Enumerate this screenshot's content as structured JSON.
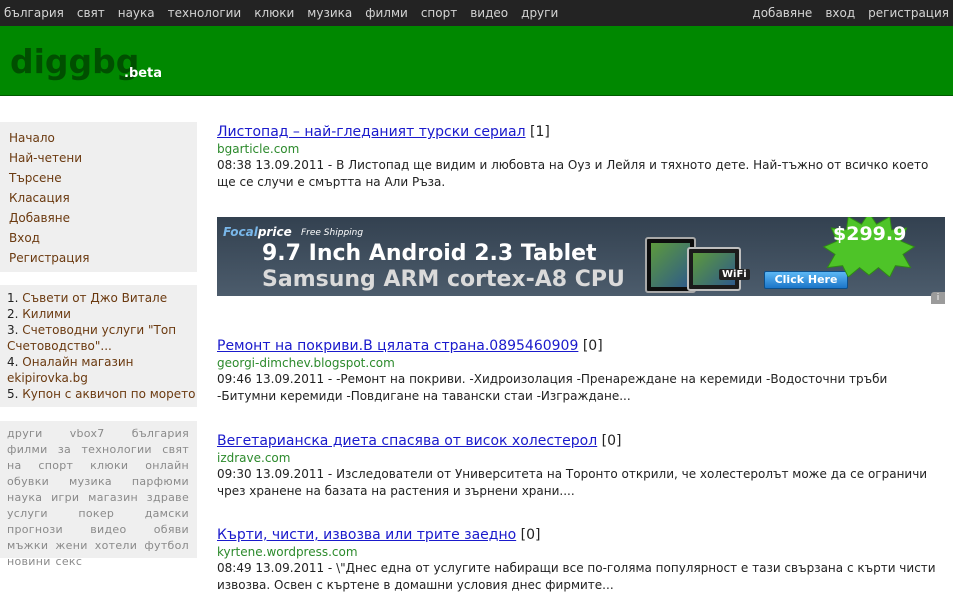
{
  "nav": {
    "left": [
      "българия",
      "свят",
      "наука",
      "технологии",
      "клюки",
      "музика",
      "филми",
      "спорт",
      "видео",
      "други"
    ],
    "right": [
      "добавяне",
      "вход",
      "регистрация"
    ]
  },
  "header": {
    "logo": "diggbg",
    "beta": ".beta"
  },
  "sidebar": {
    "menu": [
      "Начало",
      "Най-четени",
      "Търсене",
      "Класация",
      "Добавяне",
      "Вход",
      "Регистрация"
    ],
    "top_list": [
      {
        "num": "1.",
        "text": "Съвети от Джо Витале"
      },
      {
        "num": "2.",
        "text": "Килими"
      },
      {
        "num": "3.",
        "text": "Счетоводни услуги \"Топ Счетоводство\"..."
      },
      {
        "num": "4.",
        "text": "Оналайн магазин ekipirovka.bg"
      },
      {
        "num": "5.",
        "text": "Купон с аквичоп по морето"
      }
    ],
    "tags": [
      "други",
      "vbox7",
      "българия",
      "филми",
      "за",
      "технологии",
      "свят",
      "на",
      "спорт",
      "клюки",
      "онлайн",
      "обувки",
      "музика",
      "парфюми",
      "наука",
      "игри",
      "магазин",
      "здраве",
      "услуги",
      "покер",
      "дамски",
      "прогнози",
      "видео",
      "обяви",
      "мъжки",
      "жени",
      "хотели",
      "футбол",
      "новини",
      "секс"
    ]
  },
  "stories": [
    {
      "title": "Листопад – най-гледаният турски сериал",
      "count": "[1]",
      "domain": "bgarticle.com",
      "desc": "08:38 13.09.2011 - В Листопад ще видим и любовта на Оуз и Лейля и тяхното дете. Най-тъжно от всичко което ще се случи е смъртта на Али Ръза."
    },
    {
      "title": "Ремонт на покриви.В цялата страна.0895460909",
      "count": "[0]",
      "domain": "georgi-dimchev.blogspot.com",
      "desc": "09:46 13.09.2011 - -Ремонт на покриви. -Хидроизолация -Пренареждане на керемиди -Водосточни тръби -Битумни керемиди -Повдигане на тавански стаи -Изграждане..."
    },
    {
      "title": "Вегетарианска диета спасява от висок холестерол",
      "count": "[0]",
      "domain": "izdrave.com",
      "desc": "09:30 13.09.2011 - Изследователи от Университета на Торонто открили, че холестеролът може да се ограничи чрез хранене на базата на растения и зърнени храни...."
    },
    {
      "title": "Кърти, чисти, извозва или трите заедно",
      "count": "[0]",
      "domain": "kyrtene.wordpress.com",
      "desc": "08:49 13.09.2011 - \\\"Днес една от услугите набиращи все по-голяма популярност е тази свързана с кърти чисти извозва. Освен с къртене в домашни условия днес фирмите..."
    }
  ],
  "banner": {
    "brand_a": "Focal",
    "brand_b": "price",
    "shipping": "Free Shipping",
    "line1": "9.7 Inch Android 2.3 Tablet",
    "line2": "Samsung ARM cortex-A8 CPU",
    "wifi": "WiFi",
    "cta": "Click Here",
    "price": "$299.9"
  }
}
